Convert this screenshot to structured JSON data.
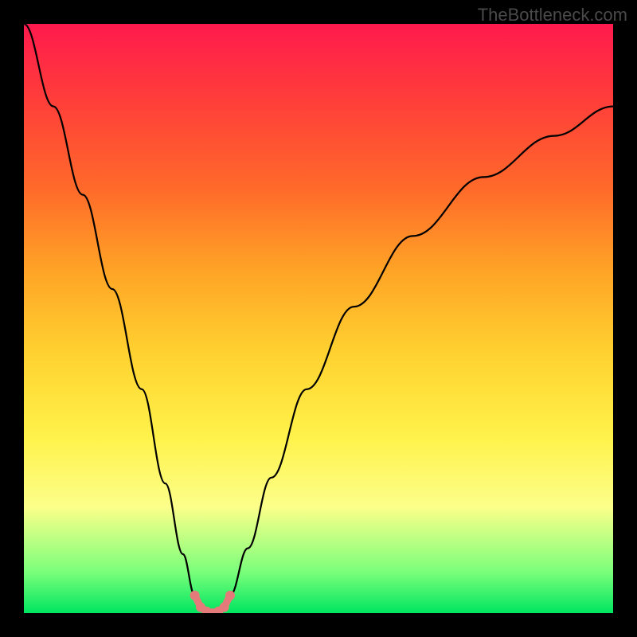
{
  "watermark": "TheBottleneck.com",
  "chart_data": {
    "type": "line",
    "title": "",
    "xlabel": "",
    "ylabel": "",
    "xlim": [
      0,
      100
    ],
    "ylim": [
      0,
      100
    ],
    "series": [
      {
        "name": "bottleneck-curve",
        "x": [
          0,
          5,
          10,
          15,
          20,
          24,
          27,
          29,
          30.5,
          32,
          33.5,
          35,
          38,
          42,
          48,
          56,
          66,
          78,
          90,
          100
        ],
        "y": [
          100,
          86,
          71,
          55,
          38,
          22,
          10,
          3,
          0.5,
          0,
          0.5,
          3,
          11,
          23,
          38,
          52,
          64,
          74,
          81,
          86
        ]
      }
    ],
    "markers": {
      "name": "highlight-dots",
      "x": [
        29.0,
        30.0,
        31.0,
        32.0,
        33.0,
        34.0,
        35.0
      ],
      "y": [
        3.0,
        1.0,
        0.3,
        0.0,
        0.3,
        1.0,
        3.0
      ]
    }
  }
}
